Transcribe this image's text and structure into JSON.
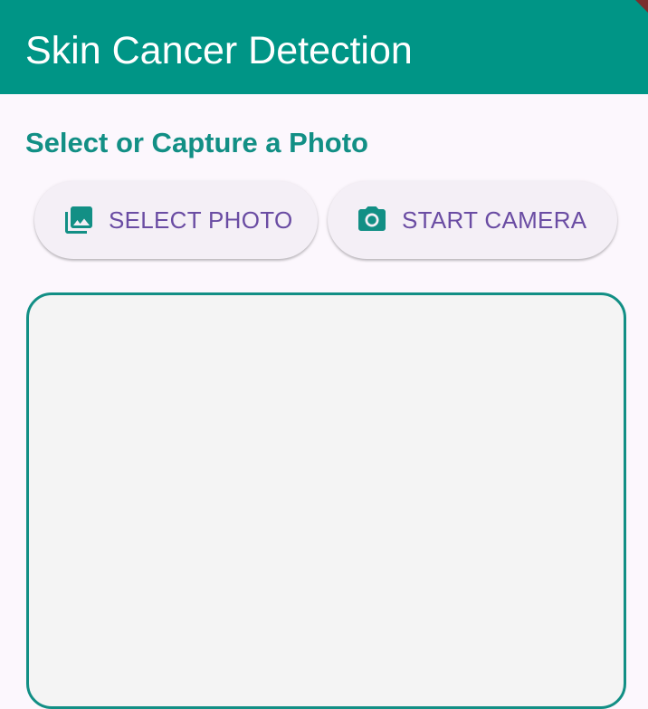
{
  "app_bar": {
    "title": "Skin Cancer Detection",
    "background_color": "#009586",
    "title_color": "#FFFFFF"
  },
  "main": {
    "heading": "Select or Capture a Photo",
    "heading_color": "#128F85",
    "buttons": [
      {
        "label": "SELECT PHOTO",
        "icon": "photo-library-icon"
      },
      {
        "label": "START CAMERA",
        "icon": "camera-icon"
      }
    ],
    "button_text_color": "#6A4CA3",
    "button_icon_color": "#128F85",
    "preview": {
      "border_color": "#128F85",
      "fill_color": "#F4F4F4"
    }
  },
  "colors": {
    "page_background": "#FCF7FD",
    "accent": "#009586"
  }
}
